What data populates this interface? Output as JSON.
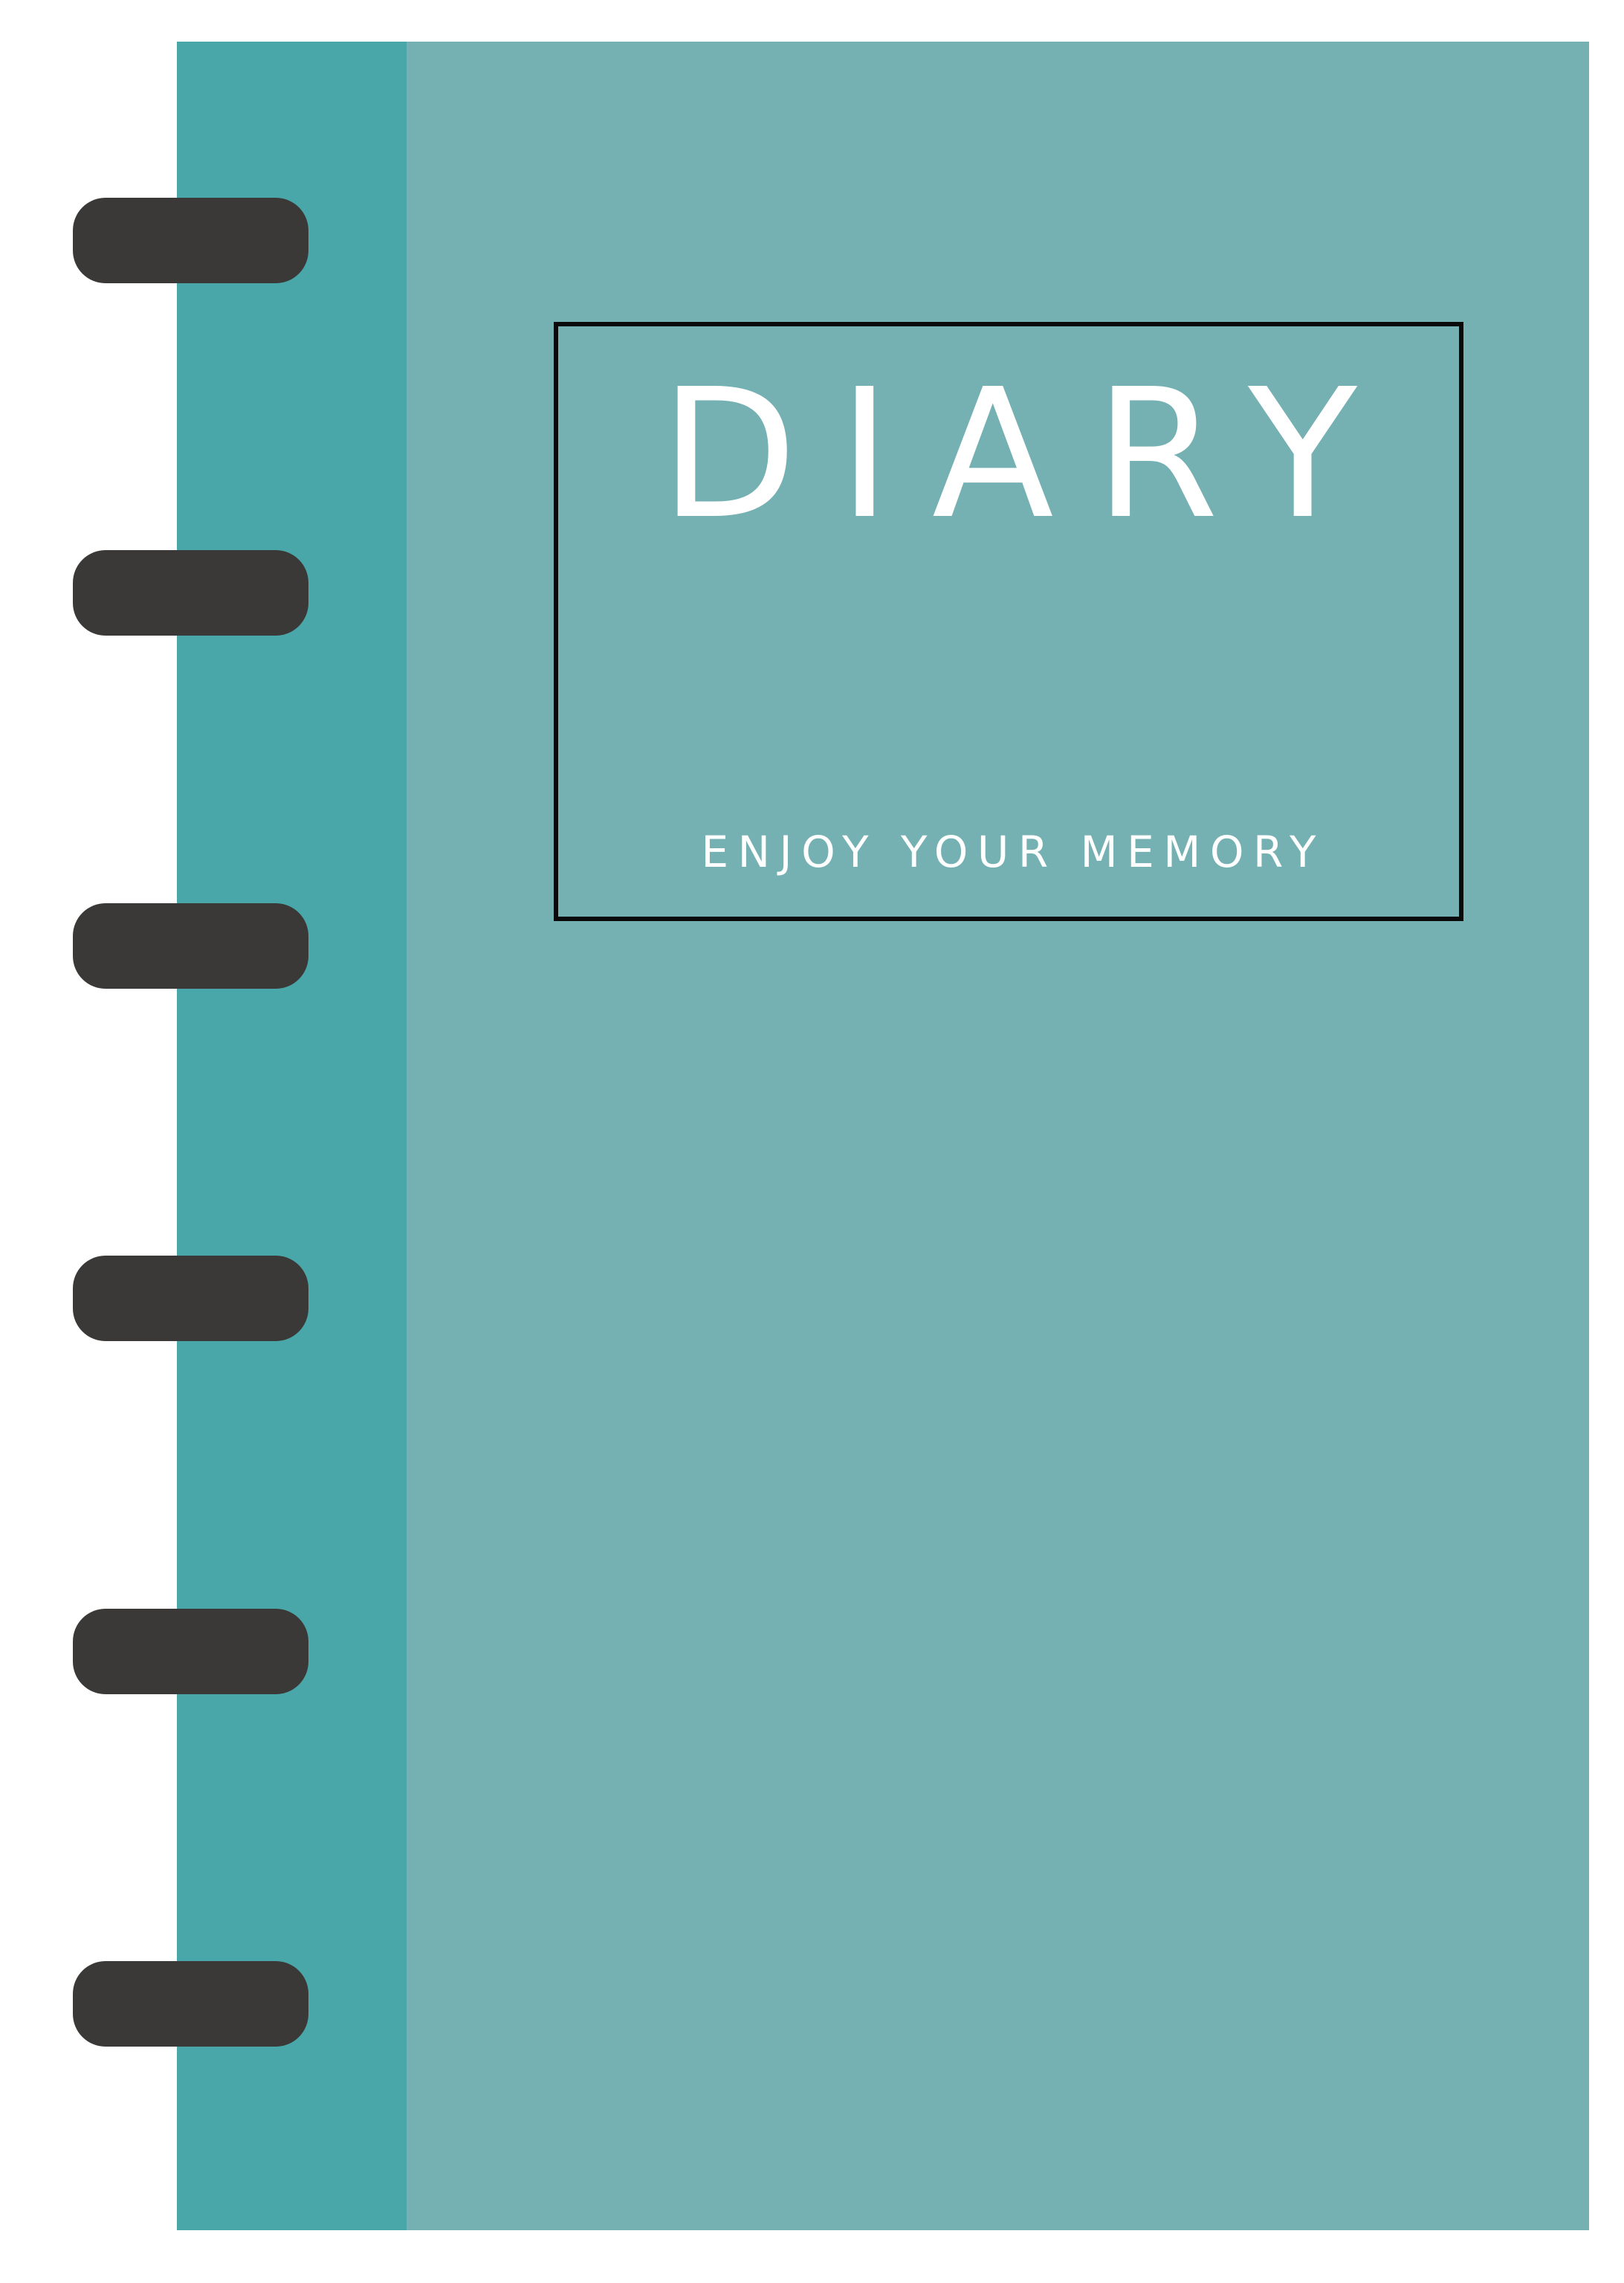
{
  "cover": {
    "title": "DIARY",
    "subtitle": "ENJOY YOUR MEMORY"
  },
  "colors": {
    "background": "#ffffff",
    "cover": "#75b1b2",
    "spine": "#49a7aa",
    "rings": "#3a3938",
    "frame": "#0a0a0a",
    "text": "#ffffff"
  },
  "binding": {
    "ring_count": 6
  }
}
